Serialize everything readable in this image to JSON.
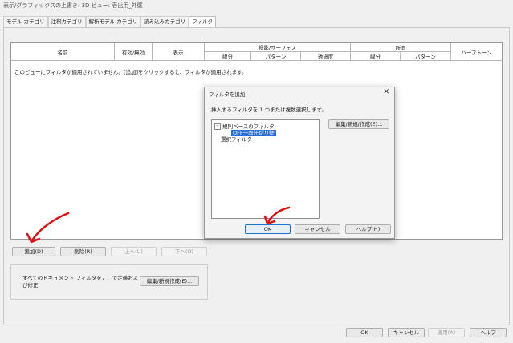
{
  "window": {
    "title": "表示/グラフィックスの上書き: 3D ビュー: 壱出用_外壁"
  },
  "tabs": [
    "モデル カテゴリ",
    "注釈カテゴリ",
    "解析モデル カテゴリ",
    "読み込みカテゴリ",
    "フィルタ"
  ],
  "table": {
    "col_name": "名前",
    "col_enabled": "有効/無効",
    "col_visible": "表示",
    "group_projection": "投影/サーフェス",
    "group_cut": "断面",
    "col_halftone": "ハーフトーン",
    "sub_projection": [
      "線分",
      "パターン",
      "透過度"
    ],
    "sub_cut": [
      "線分",
      "パターン"
    ],
    "empty_message": "このビューにフィルタが適用されていません。[追加]をクリックすると、フィルタが適用されます。"
  },
  "row_buttons": {
    "add": "追加(D)",
    "delete": "削除(R)",
    "up": "上へ(U)",
    "down": "下へ(O)"
  },
  "doc_filters": {
    "text": "すべてのドキュメント フィルタをここで定義および修正",
    "button": "編集/新規作成(E)..."
  },
  "footer": {
    "ok": "OK",
    "cancel": "キャンセル",
    "apply": "適用(A)",
    "help": "ヘルプ"
  },
  "dialog": {
    "title": "フィルタを追加",
    "close": "✕",
    "instruction": "挿入するフィルタを 1 つまたは複数選択します。",
    "tree": {
      "rule_group": "規則ベースのフィルタ",
      "rule_item": "OFF一面仕切り壁",
      "selection_group": "選択フィルタ"
    },
    "edit_button": "編集/新規/作成(E)...",
    "ok": "OK",
    "cancel": "キャンセル",
    "help": "ヘルプ(H)"
  },
  "colors": {
    "accent": "#1a72d0",
    "annotation_arrow": "#e01010",
    "selection": "#2b6fd6"
  }
}
